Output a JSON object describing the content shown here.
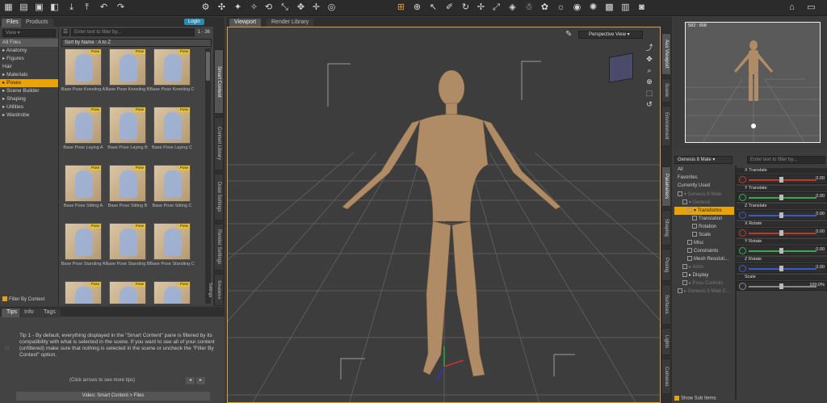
{
  "toolbar": {
    "left_icons": [
      "tile-icon",
      "folder-icon",
      "save-icon",
      "save-as-icon",
      "import-icon",
      "export-icon",
      "undo-icon",
      "redo-icon"
    ],
    "tool_icons": [
      "scene-icon",
      "node-icon",
      "joint-icon",
      "pointer-icon",
      "rotate-icon",
      "scale-icon",
      "universal-icon",
      "move-icon",
      "orbit-icon",
      "figure-icon",
      "light-icon",
      "camera-icon",
      "render-icon",
      "spot-icon",
      "cube-icon",
      "photo-icon"
    ],
    "right_icons": [
      "home-icon",
      "window-icon"
    ]
  },
  "left": {
    "tabs": [
      "Files",
      "Products"
    ],
    "login": "Login",
    "filter_placeholder": "Enter text to filter by...",
    "paging": "1 - 36",
    "sort": "Sort by Name : A to Z",
    "categories": [
      {
        "label": "All Files",
        "selected": false,
        "hl": true
      },
      {
        "label": "▸ Anatomy",
        "selected": false
      },
      {
        "label": "▸ Figures",
        "selected": false
      },
      {
        "label": "Hair",
        "selected": false
      },
      {
        "label": "▸ Materials",
        "selected": false
      },
      {
        "label": "▸ Poses",
        "selected": true
      },
      {
        "label": "▸ Scene Builder",
        "selected": false
      },
      {
        "label": "▸ Shaping",
        "selected": false
      },
      {
        "label": "▸ Utilities",
        "selected": false
      },
      {
        "label": "▸ Wardrobe",
        "selected": false
      }
    ],
    "thumb_tag": "Pose",
    "thumbs": [
      "Base Pose Kneeling A",
      "Base Pose Kneeling B",
      "Base Pose Kneeling C",
      "Base Pose Laying A",
      "Base Pose Laying B",
      "Base Pose Laying C",
      "Base Pose Sitting A",
      "Base Pose Sitting B",
      "Base Pose Sitting C",
      "Base Pose Standing A",
      "Base Pose Standing B",
      "Base Pose Standing C",
      "",
      "",
      ""
    ],
    "filter_by_context": "Filter By Context",
    "side_tabs": [
      "Smart Content",
      "Content Library",
      "Draw Settings",
      "Render Settings",
      "Simulation Settings"
    ]
  },
  "tips": {
    "tabs": [
      "Tips",
      "Info",
      "Tags"
    ],
    "text": "Tip 1 - By default, everything displayed in the \"Smart Content\" pane is filtered by its compatibility with what is selected in the scene. If you want to see all of your content (unfiltered) make sure that nothing is selected in the scene or uncheck the \"Filter By Context\" option.",
    "more": "(Click arrows to see more tips)",
    "video": "Video: Smart Content > Files"
  },
  "viewport": {
    "tabs": [
      "Viewport",
      "Render Library"
    ],
    "view_label": "Perspective View"
  },
  "aux": {
    "size": "583 : 808",
    "side_tabs": [
      "Aux Viewport",
      "Scene",
      "Environment"
    ]
  },
  "params": {
    "side_tabs": [
      "Parameters",
      "Shaping",
      "Posing",
      "Surfaces",
      "Lights",
      "Cameras"
    ],
    "figure": "Genesis 8 Male",
    "filter_placeholder": "Enter text to filter by...",
    "groups": [
      "All",
      "Favorites",
      "Currently Used"
    ],
    "tree": [
      {
        "label": "▾ Genesis 8 Male",
        "level": 0,
        "dim": true,
        "sel": false
      },
      {
        "label": "▾ General",
        "level": 1,
        "dim": true,
        "sel": false
      },
      {
        "label": "▾ Transforms",
        "level": 2,
        "dim": false,
        "sel": true
      },
      {
        "label": "Translation",
        "level": 3,
        "dim": false,
        "sel": false
      },
      {
        "label": "Rotation",
        "level": 3,
        "dim": false,
        "sel": false
      },
      {
        "label": "Scale",
        "level": 3,
        "dim": false,
        "sel": false
      },
      {
        "label": "Misc",
        "level": 2,
        "dim": false,
        "sel": false
      },
      {
        "label": "Constraints",
        "level": 2,
        "dim": false,
        "sel": false
      },
      {
        "label": "Mesh Resoluti...",
        "level": 2,
        "dim": false,
        "sel": false
      },
      {
        "label": "▸ Actor",
        "level": 1,
        "dim": true,
        "sel": false
      },
      {
        "label": "▸ Display",
        "level": 1,
        "dim": false,
        "sel": false
      },
      {
        "label": "▸ Pose Controls",
        "level": 1,
        "dim": true,
        "sel": false
      },
      {
        "label": "▸ Genesis 8 Male E...",
        "level": 0,
        "dim": true,
        "sel": false
      }
    ],
    "sliders": [
      {
        "label": "X Translate",
        "value": "0.00",
        "color": "#c0392b"
      },
      {
        "label": "Y Translate",
        "value": "0.00",
        "color": "#3aa84a"
      },
      {
        "label": "Z Translate",
        "value": "0.00",
        "color": "#3a5ac8"
      },
      {
        "label": "X Rotate",
        "value": "0.00",
        "color": "#c0392b"
      },
      {
        "label": "Y Rotate",
        "value": "0.00",
        "color": "#3aa84a"
      },
      {
        "label": "Z Rotate",
        "value": "0.00",
        "color": "#3a5ac8"
      },
      {
        "label": "Scale",
        "value": "100.0%",
        "color": "#888888"
      }
    ],
    "show_sub_items": "Show Sub Items"
  }
}
